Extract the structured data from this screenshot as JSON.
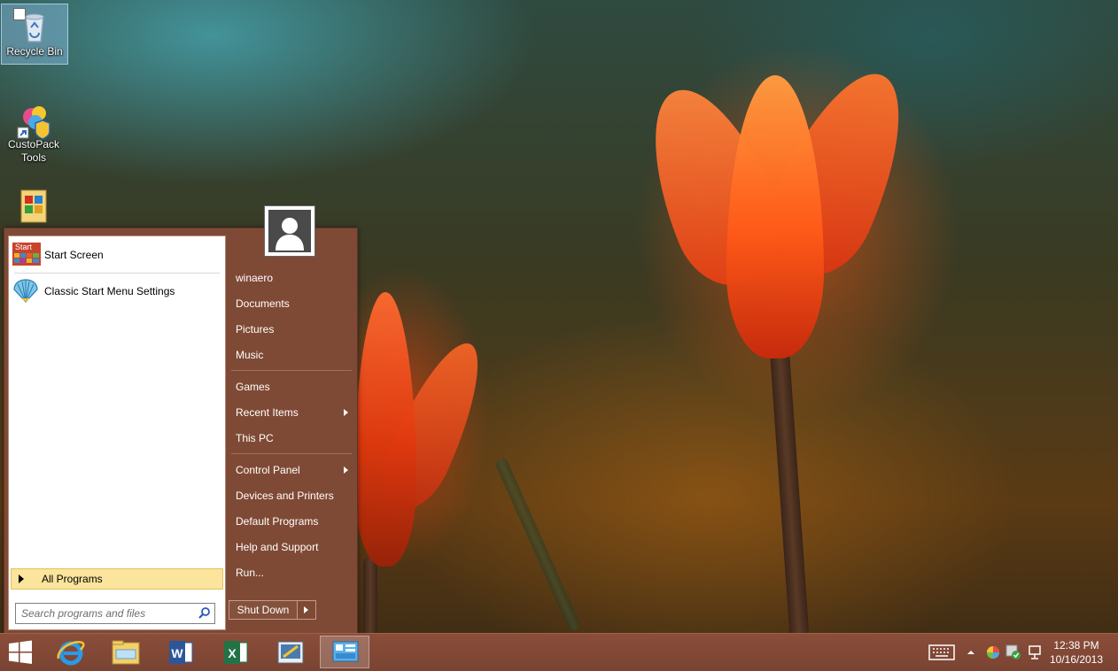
{
  "desktop": {
    "icons": [
      {
        "label": "Recycle Bin"
      },
      {
        "label": "CustoPack\nTools"
      },
      {
        "label": ""
      }
    ]
  },
  "start_menu": {
    "pinned": [
      {
        "label": "Start Screen",
        "icon": "start-screen-icon",
        "badge": "Start"
      },
      {
        "label": "Classic Start Menu Settings",
        "icon": "shell-icon"
      }
    ],
    "all_programs_label": "All Programs",
    "search_placeholder": "Search programs and files",
    "user_name": "winaero",
    "right_items": [
      {
        "label": "winaero"
      },
      {
        "label": "Documents"
      },
      {
        "label": "Pictures"
      },
      {
        "label": "Music"
      },
      {
        "label": "Games"
      },
      {
        "label": "Recent Items",
        "submenu": true
      },
      {
        "label": "This PC"
      },
      {
        "label": "Control Panel",
        "submenu": true
      },
      {
        "label": "Devices and Printers"
      },
      {
        "label": "Default Programs"
      },
      {
        "label": "Help and Support"
      },
      {
        "label": "Run..."
      }
    ],
    "shutdown_label": "Shut Down"
  },
  "taskbar": {
    "buttons": [
      {
        "icon": "windows-start-icon"
      },
      {
        "icon": "internet-explorer-icon"
      },
      {
        "icon": "file-explorer-icon"
      },
      {
        "icon": "word-icon",
        "letter": "W"
      },
      {
        "icon": "excel-icon",
        "letter": "X"
      },
      {
        "icon": "paint-icon"
      },
      {
        "icon": "control-panel-icon",
        "active": true
      }
    ],
    "tray_icons": [
      "keyboard-icon",
      "show-hidden-icons-icon",
      "color-wheel-icon",
      "security-icon",
      "network-icon"
    ],
    "clock": {
      "time": "12:38 PM",
      "date": "10/16/2013"
    }
  },
  "colors": {
    "menu_bg": "#7f4a35",
    "taskbar_bg": "#7a4332",
    "all_programs_highlight": "#fbe49b"
  }
}
